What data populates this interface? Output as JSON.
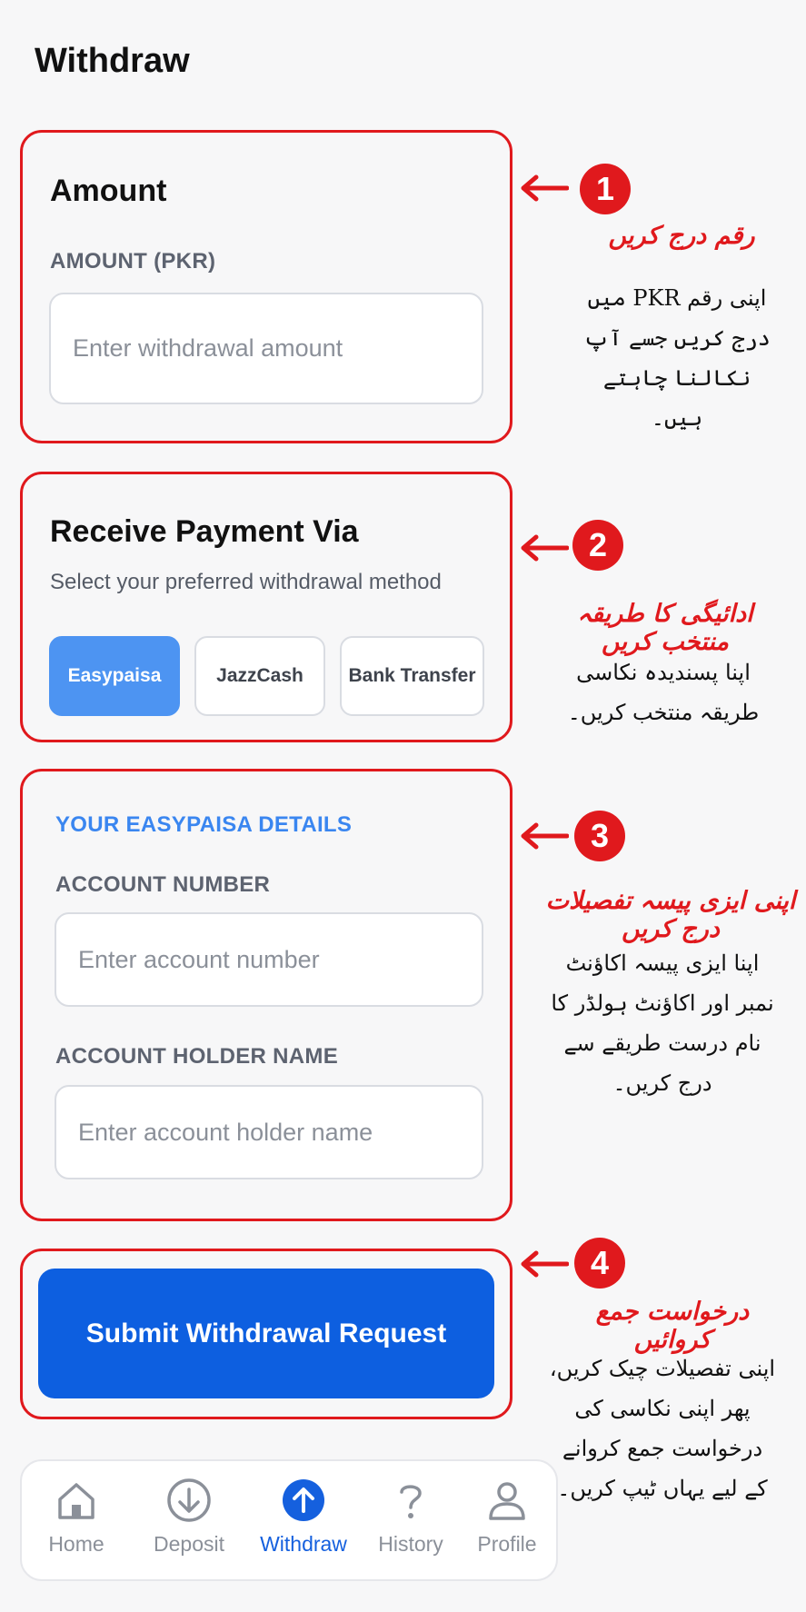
{
  "header": {
    "title": "Withdraw"
  },
  "amount_card": {
    "title": "Amount",
    "field_label": "AMOUNT (PKR)",
    "input_placeholder": "Enter withdrawal amount",
    "input_value": ""
  },
  "payment_card": {
    "title": "Receive Payment Via",
    "subtitle": "Select your preferred withdrawal method",
    "methods": [
      {
        "label": "Easypaisa",
        "selected": true
      },
      {
        "label": "JazzCash",
        "selected": false
      },
      {
        "label": "Bank Transfer",
        "selected": false
      }
    ]
  },
  "details_card": {
    "section_title": "YOUR EASYPAISA DETAILS",
    "account_number_label": "ACCOUNT NUMBER",
    "account_number_placeholder": "Enter account number",
    "holder_name_label": "ACCOUNT HOLDER NAME",
    "holder_name_placeholder": "Enter account holder name"
  },
  "submit": {
    "label": "Submit Withdrawal Request"
  },
  "annotations": [
    {
      "number": "1",
      "title": "رقم درج کریں",
      "body": "اپنی رقم PKR میں درج کریں جسے آپ نکالنا چاہتے ہیں۔"
    },
    {
      "number": "2",
      "title": "ادائیگی کا طریقہ منتخب کریں",
      "body": "اپنا پسندیدہ نکاسی طریقہ منتخب کریں۔"
    },
    {
      "number": "3",
      "title": "اپنی ایزی پیسہ تفصیلات درج کریں",
      "body": "اپنا ایزی پیسہ اکاؤنٹ نمبر اور اکاؤنٹ ہولڈر کا نام درست طریقے سے درج کریں۔"
    },
    {
      "number": "4",
      "title": "درخواست جمع کروائیں",
      "body": "اپنی تفصیلات چیک کریں، پھر اپنی نکاسی کی درخواست جمع کروانے کے لیے یہاں ٹیپ کریں۔"
    }
  ],
  "nav": {
    "items": [
      {
        "label": "Home",
        "icon": "home-icon",
        "active": false
      },
      {
        "label": "Deposit",
        "icon": "arrow-down-circle-icon",
        "active": false
      },
      {
        "label": "Withdraw",
        "icon": "arrow-up-circle-icon",
        "active": true
      },
      {
        "label": "History",
        "icon": "question-icon",
        "active": false
      },
      {
        "label": "Profile",
        "icon": "user-icon",
        "active": false
      }
    ]
  },
  "colors": {
    "accent_red": "#e0191d",
    "primary_blue": "#0d5fe0",
    "selected_method": "#4d94f2",
    "nav_active": "#1560de"
  }
}
